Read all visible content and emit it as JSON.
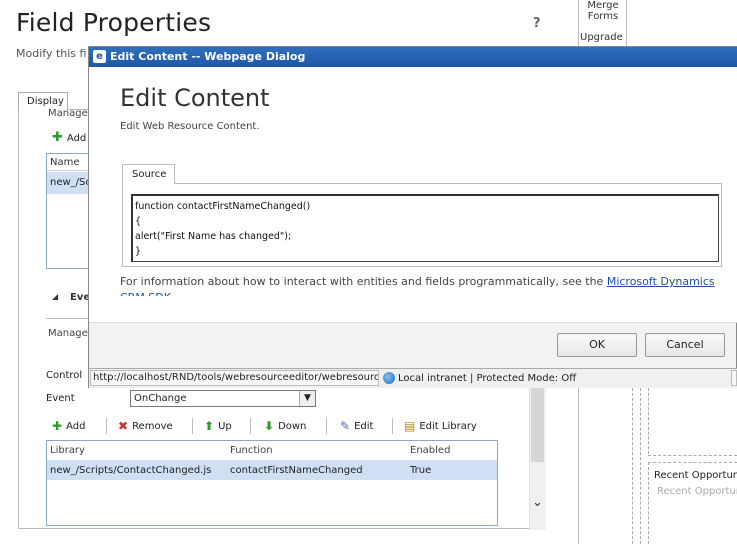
{
  "background": {
    "title": "Field Properties",
    "help": "?",
    "subtitle": "Modify this fi",
    "merge_forms": "Merge Forms",
    "upgrade": "Upgrade",
    "tab_display": "Display",
    "manage_label_1": "Manage",
    "add_label_1": "Add",
    "library_header": "Name",
    "library_row": "new_/Sc",
    "events_label": "Eve",
    "manage_label_2": "Manage",
    "control_label": "Control",
    "event_label": "Event",
    "event_value": "OnChange",
    "toolbar": {
      "add": "Add",
      "remove": "Remove",
      "up": "Up",
      "down": "Down",
      "edit": "Edit",
      "edit_library": "Edit Library"
    },
    "handlers_table": {
      "columns": [
        "Library",
        "Function",
        "Enabled"
      ],
      "rows": [
        [
          "new_/Scripts/ContactChanged.js",
          "contactFirstNameChanged",
          "True"
        ]
      ]
    },
    "recent_1": "Recent Opportun",
    "recent_2": "Recent Opportun"
  },
  "dialog": {
    "window_title": "Edit Content -- Webpage Dialog",
    "heading": "Edit Content",
    "subheading": "Edit Web Resource Content.",
    "tab_source": "Source",
    "code": "function contactFirstNameChanged()\n{\nalert(\"First Name has changed\");\n}",
    "info_text": "For information about how to interact with entities and fields programmatically, see the ",
    "info_link": "Microsoft Dynamics CRM SDK",
    "ok_label": "OK",
    "cancel_label": "Cancel",
    "status_url": "http://localhost/RND/tools/webresourceeditor/webresource",
    "status_zone": "Local intranet | Protected Mode: Off"
  }
}
